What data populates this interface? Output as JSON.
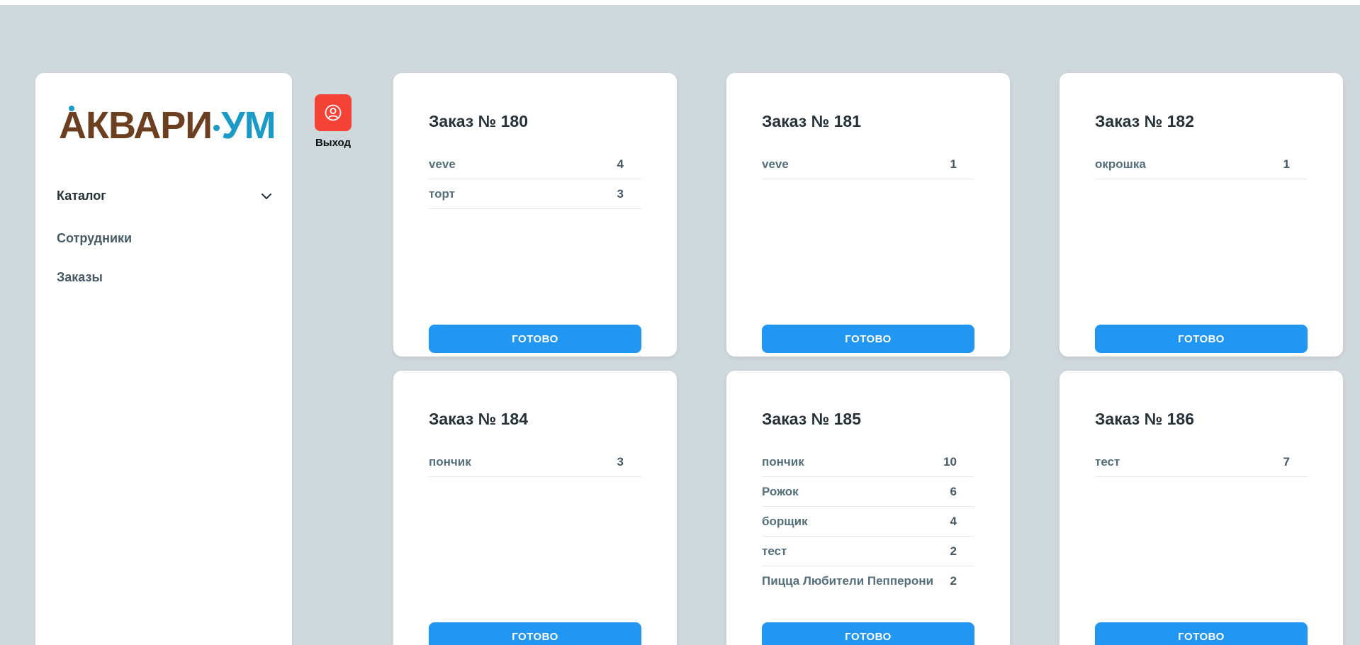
{
  "logo": {
    "part1": "АКВАРИ",
    "part2": "УМ"
  },
  "nav": {
    "catalog": "Каталог",
    "staff": "Сотрудники",
    "orders": "Заказы"
  },
  "logout": {
    "label": "Выход"
  },
  "colors": {
    "background": "#cfd8dd",
    "primary": "#2196f3",
    "danger": "#f44336",
    "logo_brown": "#6b3f1f",
    "logo_blue": "#1a9bc7"
  },
  "orders": [
    {
      "title": "Заказ № 180",
      "button": "ГОТОВО",
      "items": [
        {
          "name": "veve",
          "qty": "4"
        },
        {
          "name": "торт",
          "qty": "3"
        }
      ]
    },
    {
      "title": "Заказ № 181",
      "button": "ГОТОВО",
      "items": [
        {
          "name": "veve",
          "qty": "1"
        }
      ]
    },
    {
      "title": "Заказ № 182",
      "button": "ГОТОВО",
      "items": [
        {
          "name": "окрошка",
          "qty": "1"
        }
      ]
    },
    {
      "title": "Заказ № 184",
      "button": "ГОТОВО",
      "items": [
        {
          "name": "пончик",
          "qty": "3"
        }
      ]
    },
    {
      "title": "Заказ № 185",
      "button": "ГОТОВО",
      "items": [
        {
          "name": "пончик",
          "qty": "10"
        },
        {
          "name": "Рожок",
          "qty": "6"
        },
        {
          "name": "борщик",
          "qty": "4"
        },
        {
          "name": "тест",
          "qty": "2"
        },
        {
          "name": "Пицца Любители Пепперони",
          "qty": "2"
        }
      ]
    },
    {
      "title": "Заказ № 186",
      "button": "ГОТОВО",
      "items": [
        {
          "name": "тест",
          "qty": "7"
        }
      ]
    }
  ]
}
